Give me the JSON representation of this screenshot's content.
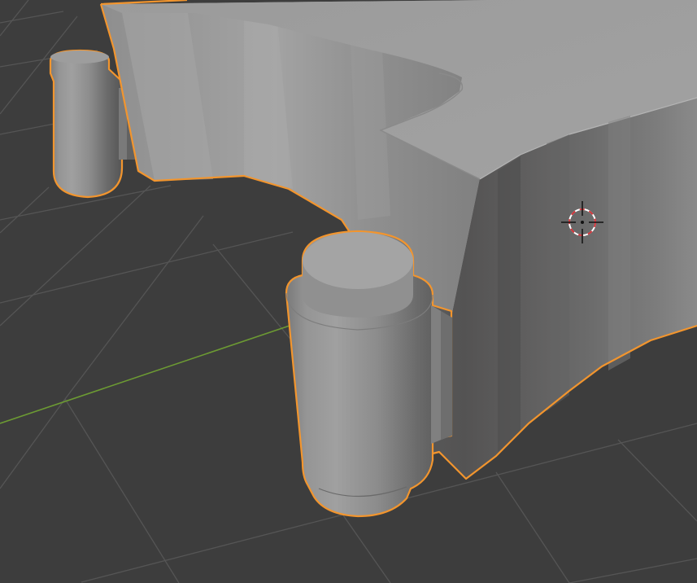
{
  "viewport": {
    "label": "3D Viewport",
    "background_color": "#3d3d3d",
    "grid_line_color": "#555555",
    "x_axis_color": "#6c9a33",
    "selection_outline_color": "#f2952e",
    "object_shading": "solid-gray",
    "objects": [
      {
        "name": "main-body",
        "selected": true
      },
      {
        "name": "rear-cylinder",
        "selected": true
      },
      {
        "name": "front-cylinder",
        "selected": true
      }
    ],
    "cursor": {
      "icon": "3d-cursor-icon"
    }
  }
}
